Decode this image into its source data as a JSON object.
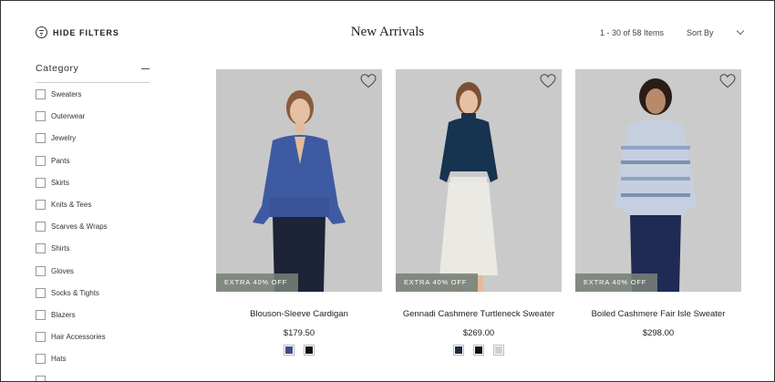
{
  "header": {
    "hide_filters_label": "HIDE FILTERS",
    "title": "New Arrivals",
    "item_count": "1 - 30 of 58 Items",
    "sort_label": "Sort By"
  },
  "sidebar": {
    "category_label": "Category",
    "filters": [
      {
        "label": "Sweaters"
      },
      {
        "label": "Outerwear"
      },
      {
        "label": "Jewelry"
      },
      {
        "label": "Pants"
      },
      {
        "label": "Skirts"
      },
      {
        "label": "Knits & Tees"
      },
      {
        "label": "Scarves & Wraps"
      },
      {
        "label": "Shirts"
      },
      {
        "label": "Gloves"
      },
      {
        "label": "Socks & Tights"
      },
      {
        "label": "Blazers"
      },
      {
        "label": "Hair Accessories"
      },
      {
        "label": "Hats"
      }
    ]
  },
  "products": [
    {
      "name": "Blouson-Sleeve Cardigan",
      "price": "$179.50",
      "badge": "EXTRA 40% OFF",
      "image": "model-blue-cardigan",
      "swatches": [
        "#3b4f8f",
        "#111111"
      ]
    },
    {
      "name": "Gennadi Cashmere Turtleneck Sweater",
      "price": "$269.00",
      "badge": "EXTRA 40% OFF",
      "image": "model-navy-turtleneck-white-skirt",
      "swatches": [
        "#1c2b44",
        "#111111",
        "#cfcfcf"
      ]
    },
    {
      "name": "Boiled Cashmere Fair Isle Sweater",
      "price": "$298.00",
      "badge": "EXTRA 40% OFF",
      "image": "model-fair-isle-sweater",
      "swatches": []
    }
  ]
}
